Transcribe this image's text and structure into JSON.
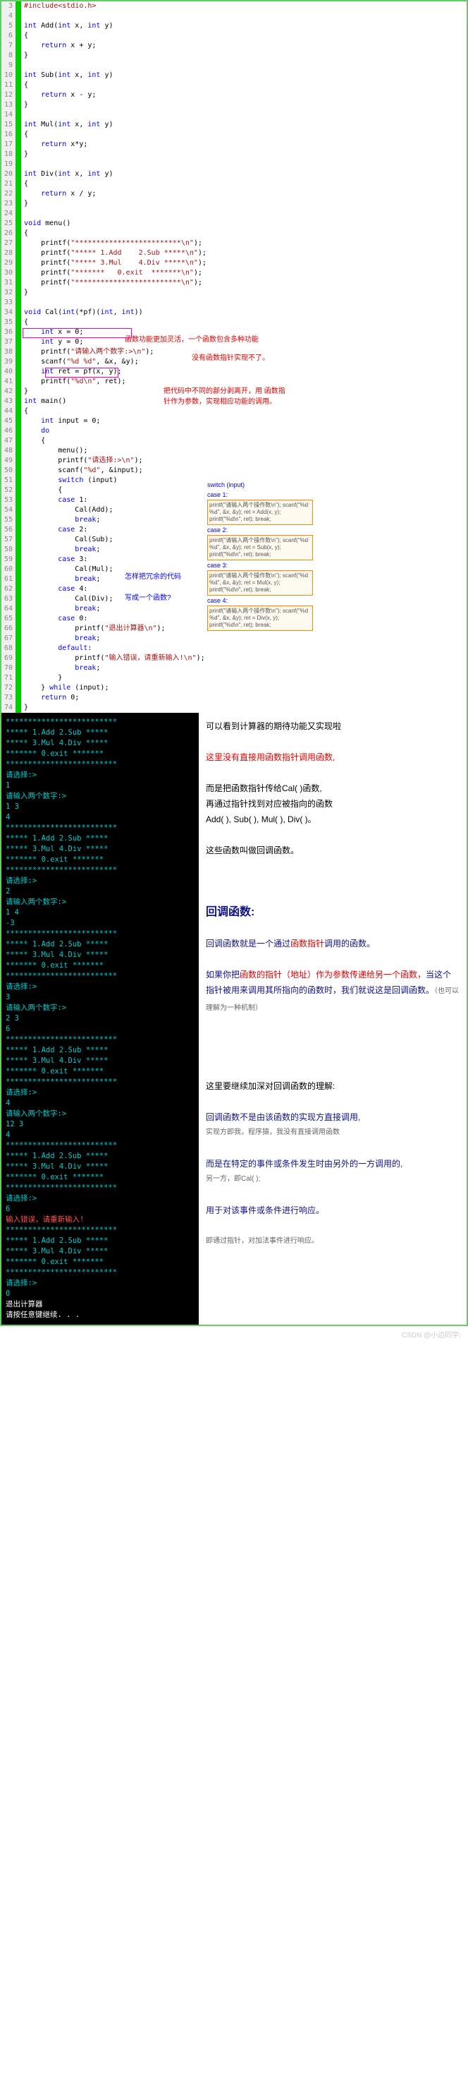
{
  "code": {
    "include": "#include<stdio.h>",
    "lines": [
      {
        "n": 3,
        "t": "#include<stdio.h>"
      },
      {
        "n": 4,
        "t": ""
      },
      {
        "n": 5,
        "t": "int Add(int x, int y)"
      },
      {
        "n": 6,
        "t": "{"
      },
      {
        "n": 7,
        "t": "    return x + y;"
      },
      {
        "n": 8,
        "t": "}"
      },
      {
        "n": 9,
        "t": ""
      },
      {
        "n": 10,
        "t": "int Sub(int x, int y)"
      },
      {
        "n": 11,
        "t": "{"
      },
      {
        "n": 12,
        "t": "    return x - y;"
      },
      {
        "n": 13,
        "t": "}"
      },
      {
        "n": 14,
        "t": ""
      },
      {
        "n": 15,
        "t": "int Mul(int x, int y)"
      },
      {
        "n": 16,
        "t": "{"
      },
      {
        "n": 17,
        "t": "    return x*y;"
      },
      {
        "n": 18,
        "t": "}"
      },
      {
        "n": 19,
        "t": ""
      },
      {
        "n": 20,
        "t": "int Div(int x, int y)"
      },
      {
        "n": 21,
        "t": "{"
      },
      {
        "n": 22,
        "t": "    return x / y;"
      },
      {
        "n": 23,
        "t": "}"
      },
      {
        "n": 24,
        "t": ""
      },
      {
        "n": 25,
        "t": "void menu()"
      },
      {
        "n": 26,
        "t": "{"
      },
      {
        "n": 27,
        "t": "    printf(\"*************************\\n\");"
      },
      {
        "n": 28,
        "t": "    printf(\"***** 1.Add    2.Sub *****\\n\");"
      },
      {
        "n": 29,
        "t": "    printf(\"***** 3.Mul    4.Div *****\\n\");"
      },
      {
        "n": 30,
        "t": "    printf(\"*******   0.exit  *******\\n\");"
      },
      {
        "n": 31,
        "t": "    printf(\"*************************\\n\");"
      },
      {
        "n": 32,
        "t": "}"
      },
      {
        "n": 33,
        "t": ""
      },
      {
        "n": 34,
        "t": "void Cal(int(*pf)(int, int))"
      },
      {
        "n": 35,
        "t": "{"
      },
      {
        "n": 36,
        "t": "    int x = 0;"
      },
      {
        "n": 37,
        "t": "    int y = 0;"
      },
      {
        "n": 38,
        "t": "    printf(\"请输入两个数字:>\\n\");"
      },
      {
        "n": 39,
        "t": "    scanf(\"%d %d\", &x, &y);"
      },
      {
        "n": 40,
        "t": "    int ret = pf(x, y);"
      },
      {
        "n": 41,
        "t": "    printf(\"%d\\n\", ret);"
      },
      {
        "n": 42,
        "t": "}"
      },
      {
        "n": 43,
        "t": "int main()"
      },
      {
        "n": 44,
        "t": "{"
      },
      {
        "n": 45,
        "t": "    int input = 0;"
      },
      {
        "n": 46,
        "t": "    do"
      },
      {
        "n": 47,
        "t": "    {"
      },
      {
        "n": 48,
        "t": "        menu();"
      },
      {
        "n": 49,
        "t": "        printf(\"请选择:>\\n\");"
      },
      {
        "n": 50,
        "t": "        scanf(\"%d\", &input);"
      },
      {
        "n": 51,
        "t": "        switch (input)"
      },
      {
        "n": 52,
        "t": "        {"
      },
      {
        "n": 53,
        "t": "        case 1:"
      },
      {
        "n": 54,
        "t": "            Cal(Add);"
      },
      {
        "n": 55,
        "t": "            break;"
      },
      {
        "n": 56,
        "t": "        case 2:"
      },
      {
        "n": 57,
        "t": "            Cal(Sub);"
      },
      {
        "n": 58,
        "t": "            break;"
      },
      {
        "n": 59,
        "t": "        case 3:"
      },
      {
        "n": 60,
        "t": "            Cal(Mul);"
      },
      {
        "n": 61,
        "t": "            break;"
      },
      {
        "n": 62,
        "t": "        case 4:"
      },
      {
        "n": 63,
        "t": "            Cal(Div);"
      },
      {
        "n": 64,
        "t": "            break;"
      },
      {
        "n": 65,
        "t": "        case 0:"
      },
      {
        "n": 66,
        "t": "            printf(\"退出计算器\\n\");"
      },
      {
        "n": 67,
        "t": "            break;"
      },
      {
        "n": 68,
        "t": "        default:"
      },
      {
        "n": 69,
        "t": "            printf(\"输入错误，请重新输入!\\n\");"
      },
      {
        "n": 70,
        "t": "            break;"
      },
      {
        "n": 71,
        "t": "        }"
      },
      {
        "n": 72,
        "t": "    } while (input);"
      },
      {
        "n": 73,
        "t": "    return 0;"
      },
      {
        "n": 74,
        "t": "}"
      }
    ]
  },
  "annotations": {
    "a1": "函数功能更加灵活，一个函数包含多种功能",
    "a2": "没有函数指针实现不了。",
    "a3": "把代码中不同的部分剥离开，用 函数指针作为参数，实现相应功能的调用。",
    "a4": "怎样把冗余的代码",
    "a5": "写成一个函数?",
    "switch_label": "switch (input)",
    "case1_label": "case 1:",
    "case2_label": "case 2:",
    "case3_label": "case 3:",
    "case4_label": "case 4:"
  },
  "snippets": {
    "s1": "printf(\"请输入两个操作数\\n\");\nscanf(\"%d %d\", &x, &y);\nret = Add(x, y);\nprintf(\"%d\\n\", ret);\nbreak;",
    "s2": "printf(\"请输入两个操作数\\n\");\nscanf(\"%d %d\", &x, &y);\nret = Sub(x, y);\nprintf(\"%d\\n\", ret);\nbreak;",
    "s3": "printf(\"请输入两个操作数\\n\");\nscanf(\"%d %d\", &x, &y);\nret = Mul(x, y);\nprintf(\"%d\\n\", ret);\nbreak;",
    "s4": "printf(\"请输入两个操作数\\n\");\nscanf(\"%d %d\", &x, &y);\nret = Div(x, y);\nprintf(\"%d\\n\", ret);\nbreak;"
  },
  "terminal": [
    "*************************",
    "***** 1.Add    2.Sub *****",
    "***** 3.Mul    4.Div *****",
    "*******   0.exit  *******",
    "*************************",
    "请选择:>",
    "1",
    "请输入两个数字:>",
    "1 3",
    "4",
    "*************************",
    "***** 1.Add    2.Sub *****",
    "***** 3.Mul    4.Div *****",
    "*******   0.exit  *******",
    "*************************",
    "请选择:>",
    "2",
    "请输入两个数字:>",
    "1 4",
    "-3",
    "*************************",
    "***** 1.Add    2.Sub *****",
    "***** 3.Mul    4.Div *****",
    "*******   0.exit  *******",
    "*************************",
    "请选择:>",
    "3",
    "请输入两个数字:>",
    "2 3",
    "6",
    "*************************",
    "***** 1.Add    2.Sub *****",
    "***** 3.Mul    4.Div *****",
    "*******   0.exit  *******",
    "*************************",
    "请选择:>",
    "4",
    "请输入两个数字:>",
    "12 3",
    "4",
    "*************************",
    "***** 1.Add    2.Sub *****",
    "***** 3.Mul    4.Div *****",
    "*******   0.exit  *******",
    "*************************",
    "请选择:>",
    "6",
    "输入错误，请重新输入!",
    "*************************",
    "***** 1.Add    2.Sub *****",
    "***** 3.Mul    4.Div *****",
    "*******   0.exit  *******",
    "*************************",
    "请选择:>",
    "0",
    "退出计算器",
    "请按任意键继续. . ."
  ],
  "terminal_red_lines": [
    "输入错误，请重新输入!"
  ],
  "notes": {
    "n1": "可以看到计算器的期待功能又实现啦",
    "n2": "这里没有直接用函数指针调用函数,",
    "n3a": "而是把函数指针传给Cal( )函数,",
    "n3b": "再通过指针找到对应被指向的函数",
    "n3c": "Add( ), Sub( ), Mul( ), Div( )。",
    "n4": "这些函数叫做回调函数",
    "n4_suffix": "。",
    "h1": "回调函数:",
    "n5a": "回调函数就是一个通过",
    "n5b": "函数指针",
    "n5c": "调用的函数。",
    "n6a": "如果你把",
    "n6b": "函数的指针（地址）作为参数传递给另一个函数，",
    "n6c": "当这个指针被用来调用其所指向的函数时，我们就说这是回调函数。",
    "n6d": "（也可以理解为一种机制）",
    "n7": "这里要继续加深对回调函数的理解:",
    "n8a": "回调函数不是由该函数的实现方直接调用,",
    "n8b": "实现方即我，程序猿，我没有直接调用函数",
    "n9a": "而是在特定的事件或条件发生时由另外的一方调用的,",
    "n9b": "另一方，即Cal( );",
    "n10a": "用于对该事件或条件进行响应。",
    "n10b": "即通过指针，对加法事件进行响应。"
  },
  "watermark": "CSDN @小边同学;"
}
